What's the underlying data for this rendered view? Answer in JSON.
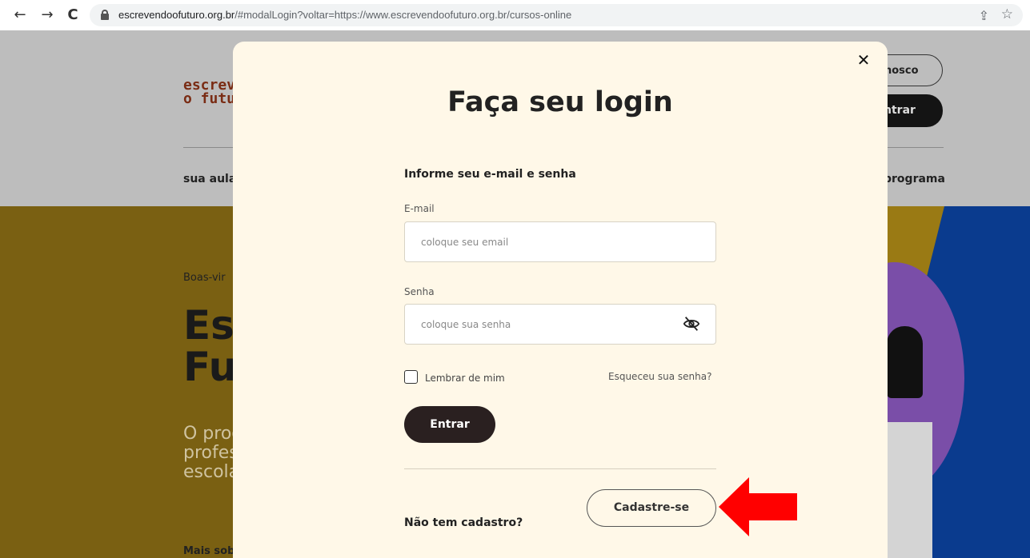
{
  "browser": {
    "url_host": "escrevendoofuturo.org.br",
    "url_rest": "/#modalLogin?voltar=https://www.escrevendoofuturo.org.br/cursos-online",
    "back_glyph": "←",
    "forward_glyph": "→",
    "reload_glyph": "C",
    "share_glyph": "⇪",
    "star_glyph": "☆"
  },
  "background": {
    "logo_line1": "escrev",
    "logo_line2": "o futu",
    "nav_left": "sua aula",
    "nav_right": "programa",
    "btn_contact": "nosco",
    "btn_enter": "ntrar",
    "welcome": "Boas-vir",
    "title_line1": "Es",
    "title_line2": "Fu",
    "desc_line1": "O prog",
    "desc_line2": "profes",
    "desc_line3": "escola",
    "more": "Mais sob"
  },
  "modal": {
    "close_glyph": "✕",
    "title": "Faça seu login",
    "subtitle": "Informe seu e-mail e senha",
    "email_label": "E-mail",
    "email_placeholder": "coloque seu email",
    "password_label": "Senha",
    "password_placeholder": "coloque sua senha",
    "remember_label": "Lembrar de mim",
    "forgot_link": "Esqueceu sua senha?",
    "login_button": "Entrar",
    "no_account_text": "Não tem cadastro?",
    "signup_button": "Cadastre-se"
  },
  "colors": {
    "modal_bg": "#fff8e8",
    "primary_button": "#2a2020",
    "annotation_arrow": "#ff0000"
  }
}
